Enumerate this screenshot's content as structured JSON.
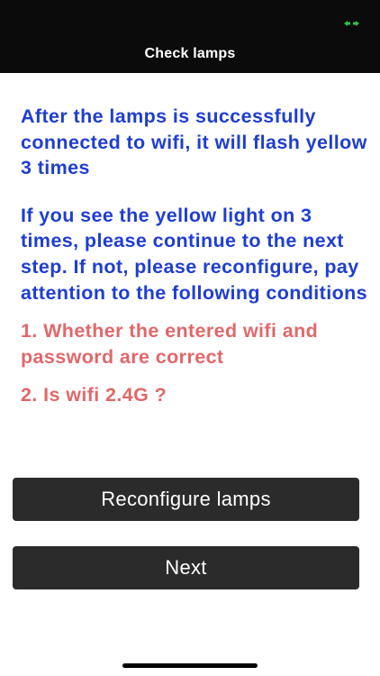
{
  "nav": {
    "title": "Check lamps"
  },
  "status": {
    "indicator_icon": "wifi-status-icon",
    "indicator_color": "#2fbf4a"
  },
  "messages": {
    "connected_info": "After the lamps is successfully connected to wifi, it will flash yellow 3 times",
    "continue_info": "If you see the yellow light on 3 times, please continue to the next step. If not, please reconfigure, pay attention to the following conditions",
    "condition_1": "1. Whether the entered wifi and password are correct",
    "condition_2": "2. Is wifi 2.4G ?"
  },
  "actions": {
    "reconfigure_label": "Reconfigure lamps",
    "next_label": "Next"
  },
  "colors": {
    "info_text": "#1f3ecf",
    "condition_text": "#e0686a",
    "button_bg": "#2b2b2b",
    "topbar_bg": "#0b0b0b"
  }
}
